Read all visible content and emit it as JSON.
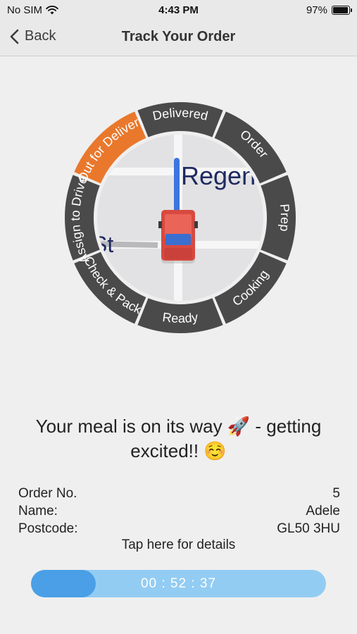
{
  "status_bar": {
    "carrier": "No SIM",
    "time": "4:43 PM",
    "battery": "97%"
  },
  "nav": {
    "back_label": "Back",
    "title": "Track Your Order"
  },
  "tracker": {
    "map_street_label": "Regen",
    "map_street_label_2": "St",
    "stages": [
      {
        "label": "Order",
        "active": false
      },
      {
        "label": "Prep",
        "active": false
      },
      {
        "label": "Cooking",
        "active": false
      },
      {
        "label": "Ready",
        "active": false
      },
      {
        "label": "Check & Pack",
        "active": false
      },
      {
        "label": "Assign to Driver",
        "active": false
      },
      {
        "label": "Out for Delivery",
        "active": true
      },
      {
        "label": "Delivered",
        "active": false
      }
    ],
    "colors": {
      "active": "#e9782d",
      "inactive": "#4a4a4a",
      "route": "#3d74e0"
    }
  },
  "message": "Your meal is on its way 🚀 - getting excited!! ☺️",
  "order": {
    "number_label": "Order No.",
    "number_value": "5",
    "name_label": "Name:",
    "name_value": "Adele",
    "postcode_label": "Postcode:",
    "postcode_value": "GL50 3HU"
  },
  "details_link": "Tap here for details",
  "timer": {
    "text": "00 : 52 : 37",
    "progress": 0.22
  }
}
